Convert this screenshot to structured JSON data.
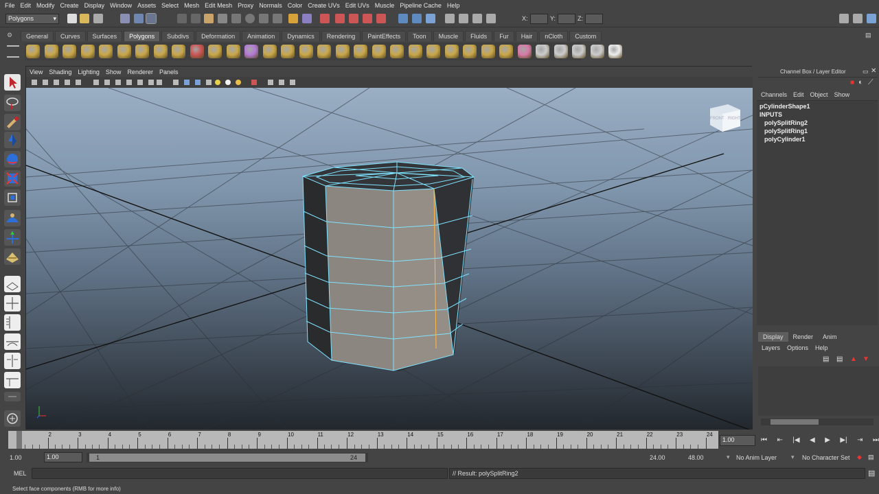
{
  "menubar": {
    "items": [
      "File",
      "Edit",
      "Modify",
      "Create",
      "Display",
      "Window",
      "Assets",
      "Select",
      "Mesh",
      "Edit Mesh",
      "Proxy",
      "Normals",
      "Color",
      "Create UVs",
      "Edit UVs",
      "Muscle",
      "Pipeline Cache",
      "Help"
    ]
  },
  "statusline": {
    "menuset": "Polygons",
    "x_label": "X:",
    "y_label": "Y:",
    "z_label": "Z:"
  },
  "shelf": {
    "tabs": [
      "General",
      "Curves",
      "Surfaces",
      "Polygons",
      "Subdivs",
      "Deformation",
      "Animation",
      "Dynamics",
      "Rendering",
      "PaintEffects",
      "Toon",
      "Muscle",
      "Fluids",
      "Fur",
      "Hair",
      "nCloth",
      "Custom"
    ],
    "active_tab": "Polygons"
  },
  "viewport": {
    "menu": [
      "View",
      "Shading",
      "Lighting",
      "Show",
      "Renderer",
      "Panels"
    ],
    "viewcube_left": "FRONT",
    "viewcube_right": "RIGHT"
  },
  "channel_box": {
    "title": "Channel Box / Layer Editor",
    "menu": [
      "Channels",
      "Edit",
      "Object",
      "Show"
    ],
    "shape_name": "pCylinderShape1",
    "inputs_label": "INPUTS",
    "inputs": [
      "polySplitRing2",
      "polySplitRing1",
      "polyCylinder1"
    ]
  },
  "layer_editor": {
    "tabs": [
      "Display",
      "Render",
      "Anim"
    ],
    "active_tab": "Display",
    "menu": [
      "Layers",
      "Options",
      "Help"
    ]
  },
  "time_slider": {
    "ticks": [
      "1",
      "2",
      "3",
      "4",
      "5",
      "6",
      "7",
      "8",
      "9",
      "10",
      "11",
      "12",
      "13",
      "14",
      "15",
      "16",
      "17",
      "18",
      "19",
      "20",
      "21",
      "22",
      "23",
      "24"
    ],
    "current_time": "1.00"
  },
  "range_slider": {
    "start_time": "1.00",
    "playback_start": "1.00",
    "range_start": "1",
    "range_end": "24",
    "playback_end": "24.00",
    "end_time": "48.00",
    "anim_layer": "No Anim Layer",
    "character_set": "No Character Set"
  },
  "command_line": {
    "language": "MEL",
    "result": "// Result: polySplitRing2"
  },
  "help_line": {
    "text": "Select face components (RMB for more info)"
  },
  "colors": {
    "ui_bg": "#444444",
    "wire_selected": "#7fe3ff",
    "sky_top": "#9aaec4",
    "floor_dark": "#22272d",
    "highlight_edge": "#ffb84a"
  }
}
